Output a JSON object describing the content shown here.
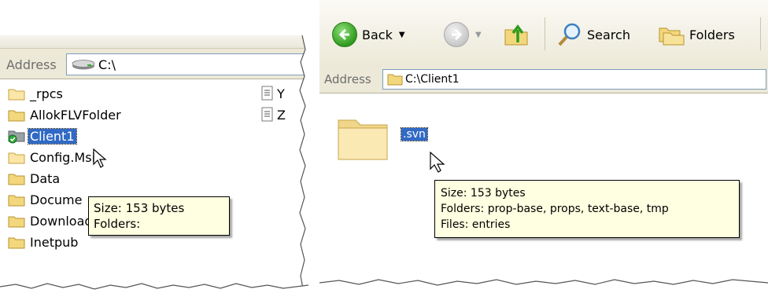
{
  "left_window": {
    "address_label": "Address",
    "address_value": "C:\\",
    "items": [
      {
        "label": "_rpcs",
        "selected": false,
        "icon": "folder-icon"
      },
      {
        "label": "AllokFLVFolder",
        "selected": false,
        "icon": "folder-icon"
      },
      {
        "label": "Client1",
        "selected": true,
        "icon": "svn-folder-icon"
      },
      {
        "label": "Config.Msi",
        "selected": false,
        "icon": "folder-icon"
      },
      {
        "label": "Data",
        "selected": false,
        "icon": "folder-icon"
      },
      {
        "label": "Docume",
        "selected": false,
        "icon": "folder-icon"
      },
      {
        "label": "Downloads",
        "selected": false,
        "icon": "folder-icon"
      },
      {
        "label": "Inetpub",
        "selected": false,
        "icon": "folder-icon"
      }
    ],
    "files": [
      {
        "label": "Y",
        "icon": "text-file-icon"
      },
      {
        "label": "Z",
        "icon": "text-file-icon"
      }
    ],
    "tooltip": {
      "line1": "Size: 153 bytes",
      "line2": "Folders:"
    }
  },
  "right_window": {
    "toolbar": {
      "back_label": "Back",
      "search_label": "Search",
      "folders_label": "Folders"
    },
    "address_label": "Address",
    "address_value": "C:\\Client1",
    "item_label": ".svn",
    "tooltip": {
      "line1": "Size: 153 bytes",
      "line2": "Folders: prop-base, props, text-base, tmp",
      "line3": "Files: entries"
    }
  },
  "colors": {
    "selection": "#316ac5",
    "tooltip_bg": "#ffffe1",
    "folder": "#f3d77d",
    "toolbar_bg": "#ece9d8"
  }
}
